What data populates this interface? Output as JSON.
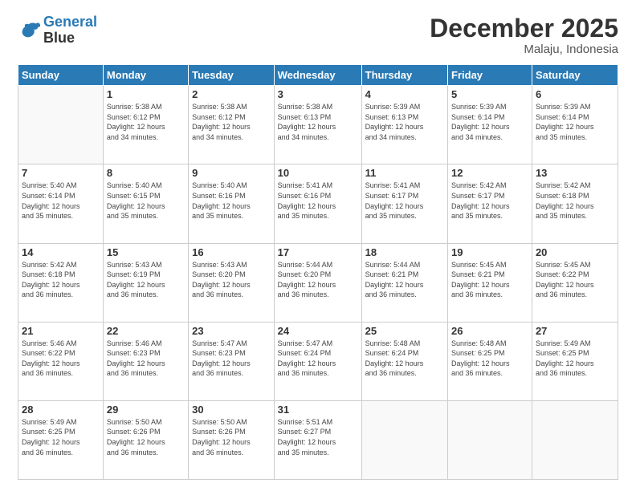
{
  "logo": {
    "line1": "General",
    "line2": "Blue"
  },
  "title": "December 2025",
  "subtitle": "Malaju, Indonesia",
  "days_of_week": [
    "Sunday",
    "Monday",
    "Tuesday",
    "Wednesday",
    "Thursday",
    "Friday",
    "Saturday"
  ],
  "weeks": [
    [
      {
        "day": null,
        "info": null
      },
      {
        "day": "1",
        "info": "Sunrise: 5:38 AM\nSunset: 6:12 PM\nDaylight: 12 hours\nand 34 minutes."
      },
      {
        "day": "2",
        "info": "Sunrise: 5:38 AM\nSunset: 6:12 PM\nDaylight: 12 hours\nand 34 minutes."
      },
      {
        "day": "3",
        "info": "Sunrise: 5:38 AM\nSunset: 6:13 PM\nDaylight: 12 hours\nand 34 minutes."
      },
      {
        "day": "4",
        "info": "Sunrise: 5:39 AM\nSunset: 6:13 PM\nDaylight: 12 hours\nand 34 minutes."
      },
      {
        "day": "5",
        "info": "Sunrise: 5:39 AM\nSunset: 6:14 PM\nDaylight: 12 hours\nand 34 minutes."
      },
      {
        "day": "6",
        "info": "Sunrise: 5:39 AM\nSunset: 6:14 PM\nDaylight: 12 hours\nand 35 minutes."
      }
    ],
    [
      {
        "day": "7",
        "info": "Sunrise: 5:40 AM\nSunset: 6:14 PM\nDaylight: 12 hours\nand 35 minutes."
      },
      {
        "day": "8",
        "info": "Sunrise: 5:40 AM\nSunset: 6:15 PM\nDaylight: 12 hours\nand 35 minutes."
      },
      {
        "day": "9",
        "info": "Sunrise: 5:40 AM\nSunset: 6:16 PM\nDaylight: 12 hours\nand 35 minutes."
      },
      {
        "day": "10",
        "info": "Sunrise: 5:41 AM\nSunset: 6:16 PM\nDaylight: 12 hours\nand 35 minutes."
      },
      {
        "day": "11",
        "info": "Sunrise: 5:41 AM\nSunset: 6:17 PM\nDaylight: 12 hours\nand 35 minutes."
      },
      {
        "day": "12",
        "info": "Sunrise: 5:42 AM\nSunset: 6:17 PM\nDaylight: 12 hours\nand 35 minutes."
      },
      {
        "day": "13",
        "info": "Sunrise: 5:42 AM\nSunset: 6:18 PM\nDaylight: 12 hours\nand 35 minutes."
      }
    ],
    [
      {
        "day": "14",
        "info": "Sunrise: 5:42 AM\nSunset: 6:18 PM\nDaylight: 12 hours\nand 36 minutes."
      },
      {
        "day": "15",
        "info": "Sunrise: 5:43 AM\nSunset: 6:19 PM\nDaylight: 12 hours\nand 36 minutes."
      },
      {
        "day": "16",
        "info": "Sunrise: 5:43 AM\nSunset: 6:20 PM\nDaylight: 12 hours\nand 36 minutes."
      },
      {
        "day": "17",
        "info": "Sunrise: 5:44 AM\nSunset: 6:20 PM\nDaylight: 12 hours\nand 36 minutes."
      },
      {
        "day": "18",
        "info": "Sunrise: 5:44 AM\nSunset: 6:21 PM\nDaylight: 12 hours\nand 36 minutes."
      },
      {
        "day": "19",
        "info": "Sunrise: 5:45 AM\nSunset: 6:21 PM\nDaylight: 12 hours\nand 36 minutes."
      },
      {
        "day": "20",
        "info": "Sunrise: 5:45 AM\nSunset: 6:22 PM\nDaylight: 12 hours\nand 36 minutes."
      }
    ],
    [
      {
        "day": "21",
        "info": "Sunrise: 5:46 AM\nSunset: 6:22 PM\nDaylight: 12 hours\nand 36 minutes."
      },
      {
        "day": "22",
        "info": "Sunrise: 5:46 AM\nSunset: 6:23 PM\nDaylight: 12 hours\nand 36 minutes."
      },
      {
        "day": "23",
        "info": "Sunrise: 5:47 AM\nSunset: 6:23 PM\nDaylight: 12 hours\nand 36 minutes."
      },
      {
        "day": "24",
        "info": "Sunrise: 5:47 AM\nSunset: 6:24 PM\nDaylight: 12 hours\nand 36 minutes."
      },
      {
        "day": "25",
        "info": "Sunrise: 5:48 AM\nSunset: 6:24 PM\nDaylight: 12 hours\nand 36 minutes."
      },
      {
        "day": "26",
        "info": "Sunrise: 5:48 AM\nSunset: 6:25 PM\nDaylight: 12 hours\nand 36 minutes."
      },
      {
        "day": "27",
        "info": "Sunrise: 5:49 AM\nSunset: 6:25 PM\nDaylight: 12 hours\nand 36 minutes."
      }
    ],
    [
      {
        "day": "28",
        "info": "Sunrise: 5:49 AM\nSunset: 6:25 PM\nDaylight: 12 hours\nand 36 minutes."
      },
      {
        "day": "29",
        "info": "Sunrise: 5:50 AM\nSunset: 6:26 PM\nDaylight: 12 hours\nand 36 minutes."
      },
      {
        "day": "30",
        "info": "Sunrise: 5:50 AM\nSunset: 6:26 PM\nDaylight: 12 hours\nand 36 minutes."
      },
      {
        "day": "31",
        "info": "Sunrise: 5:51 AM\nSunset: 6:27 PM\nDaylight: 12 hours\nand 35 minutes."
      },
      {
        "day": null,
        "info": null
      },
      {
        "day": null,
        "info": null
      },
      {
        "day": null,
        "info": null
      }
    ]
  ]
}
